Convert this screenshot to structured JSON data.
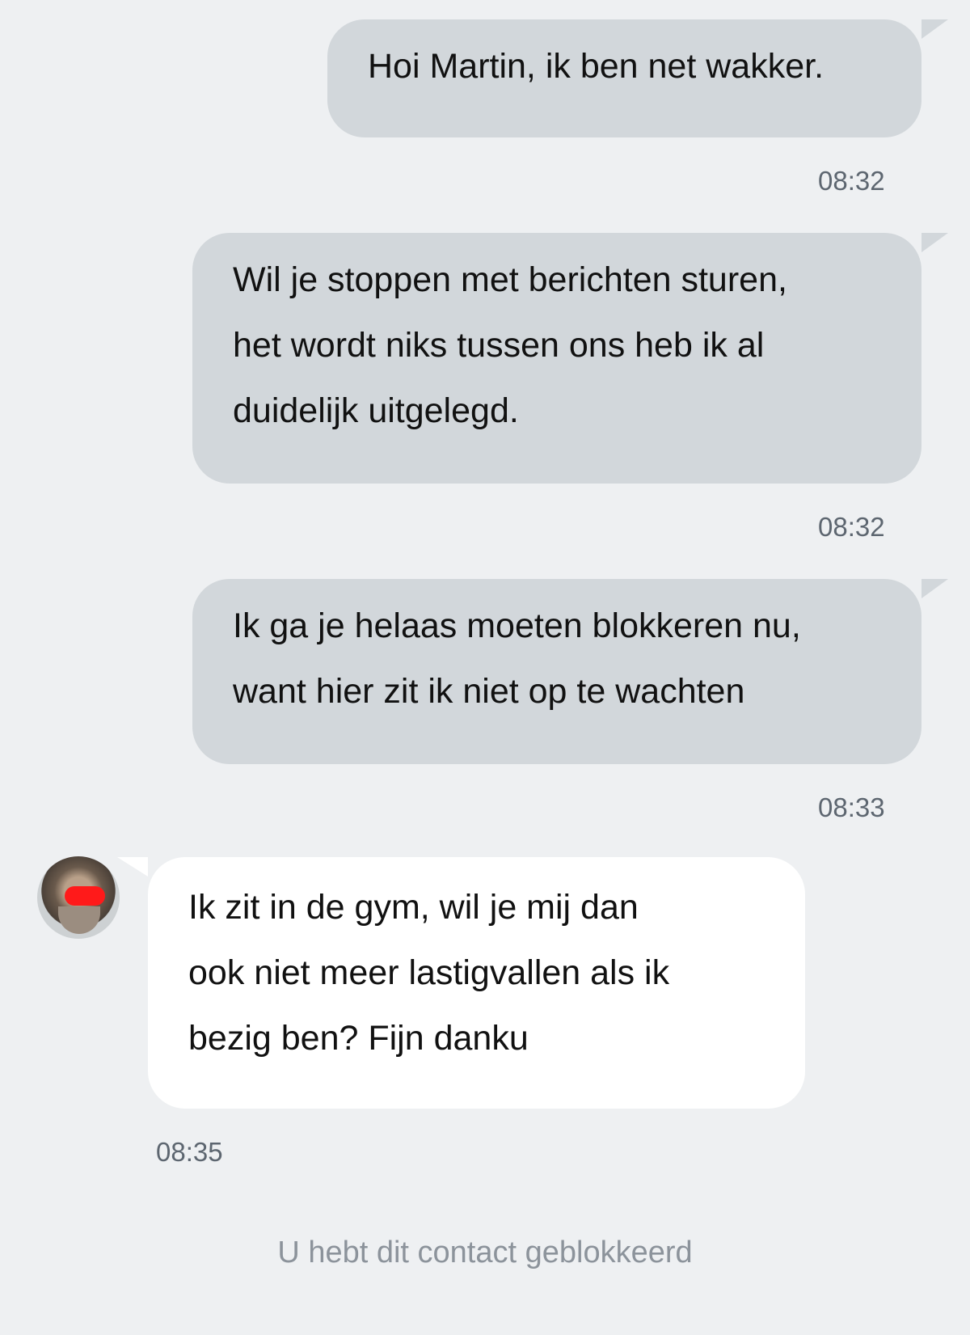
{
  "messages": [
    {
      "direction": "sent",
      "lines": [
        "Hoi Martin, ik ben net wakker."
      ],
      "time": "08:32"
    },
    {
      "direction": "sent",
      "lines": [
        "Wil je stoppen met berichten sturen,",
        "het wordt niks tussen ons heb ik al",
        "duidelijk uitgelegd."
      ],
      "time": "08:32"
    },
    {
      "direction": "sent",
      "lines": [
        "Ik ga je helaas moeten blokkeren nu,",
        "want hier zit ik niet op te wachten"
      ],
      "time": "08:33"
    },
    {
      "direction": "received",
      "lines": [
        "Ik zit in de gym, wil je mij dan",
        "ook niet meer lastigvallen als ik",
        "bezig ben? Fijn danku"
      ],
      "time": "08:35"
    }
  ],
  "status_note": "U hebt dit contact geblokkeerd",
  "colors": {
    "background": "#eef0f2",
    "sent_bubble": "#d2d7db",
    "received_bubble": "#ffffff",
    "timestamp": "#5d6670",
    "status_note": "#8c939b"
  }
}
